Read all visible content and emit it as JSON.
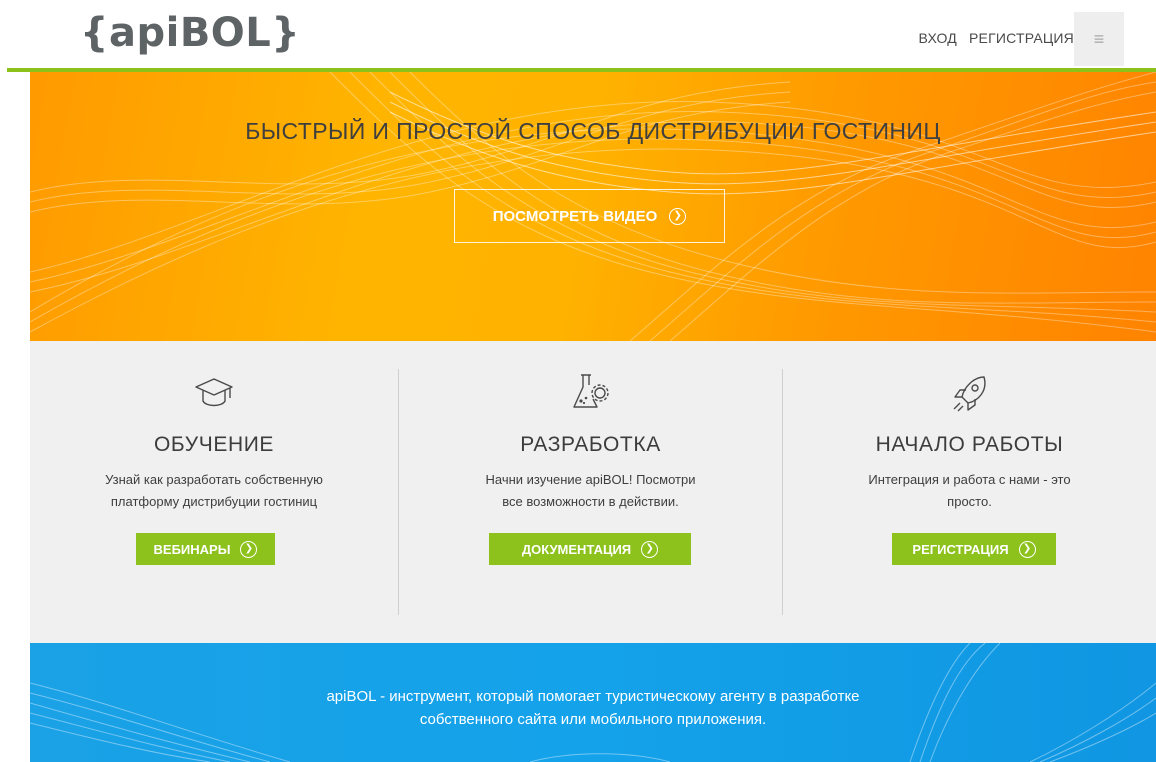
{
  "header": {
    "logo": "{apiBOL}",
    "nav": {
      "login": "ВХОД",
      "register": "РЕГИСТРАЦИЯ"
    },
    "menu_icon": "≡"
  },
  "hero": {
    "title": "БЫСТРЫЙ И ПРОСТОЙ СПОСОБ ДИСТРИБУЦИИ ГОСТИНИЦ",
    "video_button": "ПОСМОТРЕТЬ ВИДЕО"
  },
  "features": [
    {
      "icon": "graduation-cap-icon",
      "title": "ОБУЧЕНИЕ",
      "text1": "Узнай как разработать собственную",
      "text2": "платформу дистрибуции гостиниц",
      "button": "ВЕБИНАРЫ"
    },
    {
      "icon": "flask-gear-icon",
      "title": "РАЗРАБОТКА",
      "text1": "Начни изучение apiBOL! Посмотри",
      "text2": "все возможности в действии.",
      "button": "ДОКУМЕНТАЦИЯ"
    },
    {
      "icon": "rocket-icon",
      "title": "НАЧАЛО РАБОТЫ",
      "text1": "Интеграция и работа с нами - это",
      "text2": "просто.",
      "button": "РЕГИСТРАЦИЯ"
    }
  ],
  "about": {
    "line1": "apiBOL - инструмент, который помогает туристическому агенту в разработке",
    "line2": "собственного сайта или мобильного приложения."
  },
  "colors": {
    "accent_green": "#8cc21b",
    "hero_orange": "#ffa800",
    "band_blue": "#14a2ea"
  }
}
